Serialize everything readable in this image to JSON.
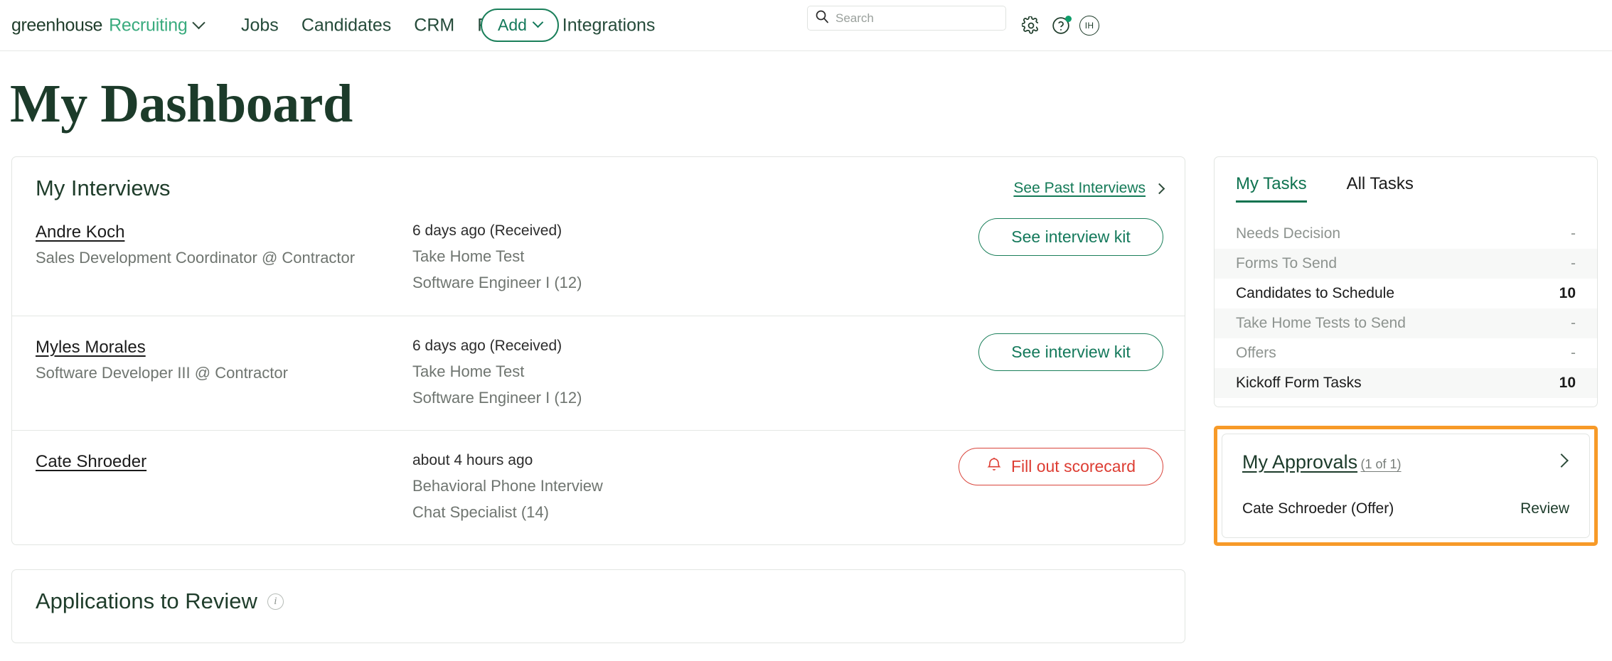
{
  "topnav": {
    "brand_primary": "greenhouse",
    "brand_secondary": "Recruiting",
    "links": [
      {
        "label": "Jobs"
      },
      {
        "label": "Candidates"
      },
      {
        "label": "CRM"
      },
      {
        "label": "Reports"
      },
      {
        "label": "Integrations"
      }
    ],
    "add_label": "Add",
    "search_placeholder": "Search",
    "search_value": "",
    "avatar_initials": "IH",
    "icons": {
      "search": "search-icon",
      "gear": "gear-icon",
      "help": "help-circle-icon",
      "notification_dot_color": "#0f9d6a"
    }
  },
  "page": {
    "title": "My Dashboard"
  },
  "interviews": {
    "title": "My Interviews",
    "see_past_label": "See Past Interviews",
    "rows": [
      {
        "candidate": "Andre Koch",
        "role": "Sales Development Coordinator @ Contractor",
        "when": "6 days ago (Received)",
        "stage": "Take Home Test",
        "job": "Software Engineer I (12)",
        "action": "See interview kit",
        "action_type": "primary"
      },
      {
        "candidate": "Myles Morales",
        "role": "Software Developer III @ Contractor",
        "when": "6 days ago (Received)",
        "stage": "Take Home Test",
        "job": "Software Engineer I (12)",
        "action": "See interview kit",
        "action_type": "primary"
      },
      {
        "candidate": "Cate Shroeder",
        "role": "",
        "when": "about 4 hours ago",
        "stage": "Behavioral Phone Interview",
        "job": "Chat Specialist (14)",
        "action": "Fill out scorecard",
        "action_type": "danger"
      }
    ]
  },
  "applications_to_review": {
    "title": "Applications to Review"
  },
  "tasks": {
    "tabs": [
      {
        "label": "My Tasks",
        "active": true
      },
      {
        "label": "All Tasks",
        "active": false
      }
    ],
    "rows": [
      {
        "label": "Needs Decision",
        "value": "-",
        "dim": true
      },
      {
        "label": "Forms To Send",
        "value": "-",
        "dim": true
      },
      {
        "label": "Candidates to Schedule",
        "value": "10",
        "dim": false
      },
      {
        "label": "Take Home Tests to Send",
        "value": "-",
        "dim": true
      },
      {
        "label": "Offers",
        "value": "-",
        "dim": true
      },
      {
        "label": "Kickoff Form Tasks",
        "value": "10",
        "dim": false
      }
    ]
  },
  "approvals": {
    "title": "My Approvals",
    "count": "(1 of 1)",
    "highlight_color": "#f79a28",
    "row": {
      "name": "Cate Schroeder (Offer)",
      "action": "Review"
    }
  }
}
